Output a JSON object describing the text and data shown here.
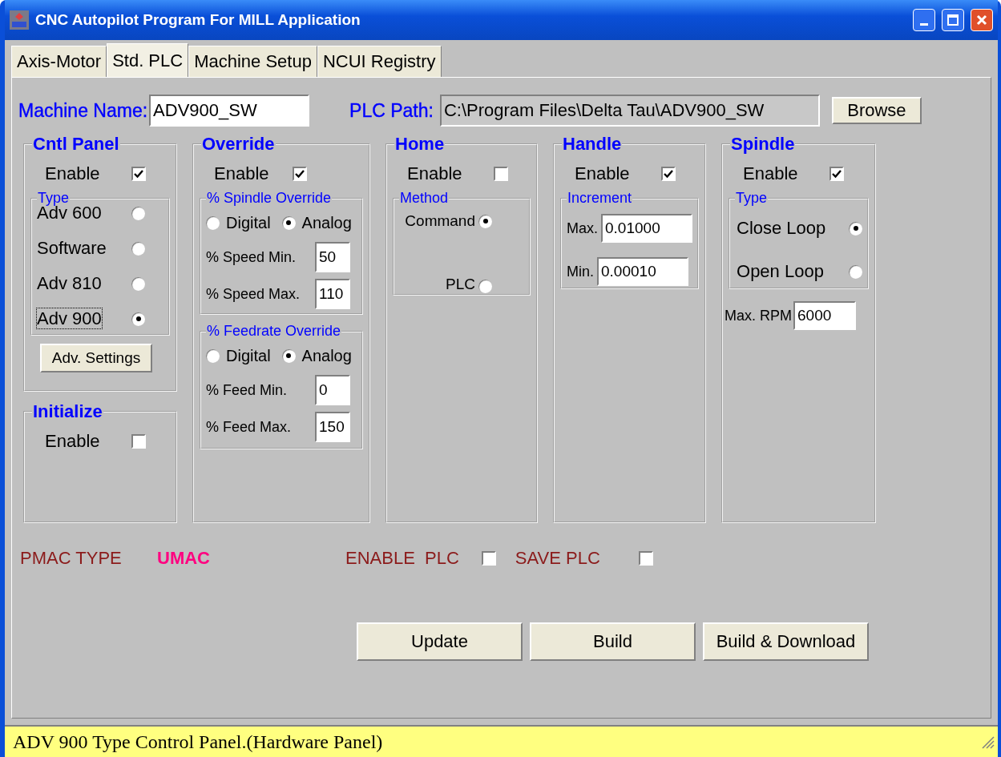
{
  "window": {
    "title": "CNC Autopilot Program For MILL Application"
  },
  "tabs": [
    {
      "label": "Axis-Motor",
      "selected": false
    },
    {
      "label": "Std. PLC",
      "selected": true
    },
    {
      "label": "Machine Setup",
      "selected": false
    },
    {
      "label": "NCUI Registry",
      "selected": false
    }
  ],
  "machine_name": {
    "label": "Machine Name:",
    "value": "ADV900_SW"
  },
  "plc_path": {
    "label": "PLC Path:",
    "value": "C:\\Program Files\\Delta Tau\\ADV900_SW",
    "button": "Browse"
  },
  "cntl_panel": {
    "title": "Cntl Panel",
    "enable": {
      "label": "Enable",
      "checked": true
    },
    "type": {
      "title": "Type",
      "options": [
        {
          "label": "Adv 600",
          "selected": false,
          "focused": false
        },
        {
          "label": "Software",
          "selected": false,
          "focused": false
        },
        {
          "label": "Adv 810",
          "selected": false,
          "focused": false
        },
        {
          "label": "Adv 900",
          "selected": true,
          "focused": true
        }
      ]
    },
    "button": "Adv. Settings"
  },
  "initialize": {
    "title": "Initialize",
    "enable": {
      "label": "Enable",
      "checked": false
    }
  },
  "override": {
    "title": "Override",
    "enable": {
      "label": "Enable",
      "checked": true
    },
    "spindle": {
      "title": "% Spindle Override",
      "modes": [
        {
          "label": "Digital",
          "selected": false
        },
        {
          "label": "Analog",
          "selected": true
        }
      ],
      "fields": [
        {
          "label": "% Speed Min.",
          "value": "50"
        },
        {
          "label": "% Speed Max.",
          "value": "110"
        }
      ]
    },
    "feedrate": {
      "title": "% Feedrate Override",
      "modes": [
        {
          "label": "Digital",
          "selected": false
        },
        {
          "label": "Analog",
          "selected": true
        }
      ],
      "fields": [
        {
          "label": "% Feed Min.",
          "value": "0"
        },
        {
          "label": "% Feed Max.",
          "value": "150"
        }
      ]
    }
  },
  "home": {
    "title": "Home",
    "enable": {
      "label": "Enable",
      "checked": false
    },
    "method": {
      "title": "Method",
      "options": [
        {
          "label": "Command",
          "selected": true
        },
        {
          "label": "PLC",
          "selected": false
        }
      ]
    }
  },
  "handle": {
    "title": "Handle",
    "enable": {
      "label": "Enable",
      "checked": true
    },
    "increment": {
      "title": "Increment",
      "fields": [
        {
          "label": "Max.",
          "value": "0.01000"
        },
        {
          "label": "Min.",
          "value": "0.00010"
        }
      ]
    }
  },
  "spindle": {
    "title": "Spindle",
    "enable": {
      "label": "Enable",
      "checked": true
    },
    "type": {
      "title": "Type",
      "options": [
        {
          "label": "Close Loop",
          "selected": true
        },
        {
          "label": "Open Loop",
          "selected": false
        }
      ]
    },
    "max_rpm": {
      "label": "Max. RPM",
      "value": "6000"
    }
  },
  "pmac": {
    "label": "PMAC TYPE",
    "value": "UMAC"
  },
  "enable_plc": {
    "label": "ENABLE  PLC",
    "checked": false
  },
  "save_plc": {
    "label": "SAVE PLC",
    "checked": false
  },
  "actions": [
    "Update",
    "Build",
    "Build & Download"
  ],
  "status_bar": "ADV 900 Type Control Panel.(Hardware Panel)"
}
